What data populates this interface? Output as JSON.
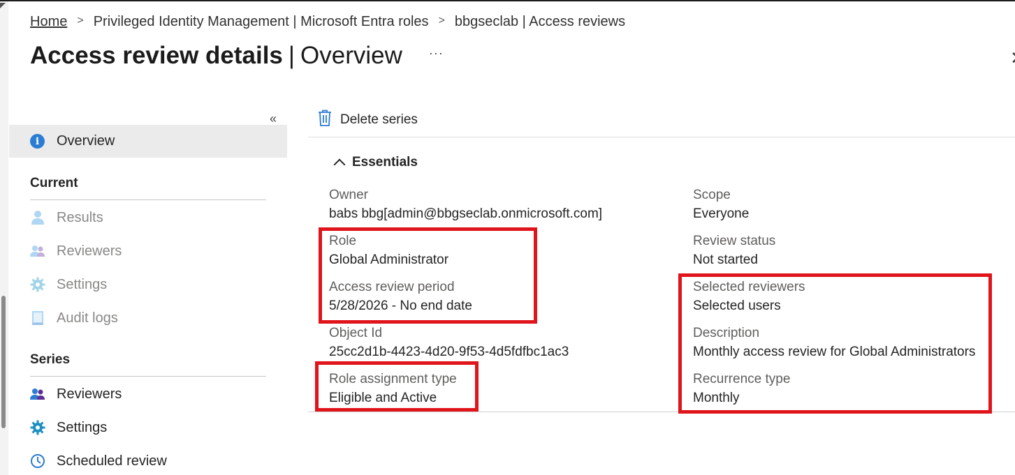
{
  "breadcrumb": {
    "home": "Home",
    "items": [
      "Privileged Identity Management | Microsoft Entra roles",
      "bbgseclab | Access reviews"
    ],
    "separator": ">"
  },
  "header": {
    "title_main": "Access review details",
    "title_sub": "Overview",
    "more": "···"
  },
  "sidebar": {
    "collapse": "«",
    "overview": "Overview",
    "current_heading": "Current",
    "current_items": [
      "Results",
      "Reviewers",
      "Settings",
      "Audit logs"
    ],
    "series_heading": "Series",
    "series_items": [
      "Reviewers",
      "Settings",
      "Scheduled review"
    ]
  },
  "commands": {
    "delete_series": "Delete series"
  },
  "essentials": {
    "toggle_label": "Essentials",
    "left": [
      {
        "label": "Owner",
        "value": "babs bbg[admin@bbgseclab.onmicrosoft.com]"
      },
      {
        "label": "Role",
        "value": "Global Administrator"
      },
      {
        "label": "Access review period",
        "value": "5/28/2026 - No end date"
      },
      {
        "label": "Object Id",
        "value": "25cc2d1b-4423-4d20-9f53-4d5fdfbc1ac3"
      },
      {
        "label": "Role assignment type",
        "value": "Eligible and Active"
      }
    ],
    "right": [
      {
        "label": "Scope",
        "value": "Everyone"
      },
      {
        "label": "Review status",
        "value": "Not started"
      },
      {
        "label": "Selected reviewers",
        "value": "Selected users"
      },
      {
        "label": "Description",
        "value": "Monthly access review for Global Administrators"
      },
      {
        "label": "Recurrence type",
        "value": "Monthly"
      }
    ]
  },
  "colors": {
    "highlight": "#e0141b",
    "accent": "#2b7cd3",
    "selected_nav_bg": "#ebebeb"
  }
}
